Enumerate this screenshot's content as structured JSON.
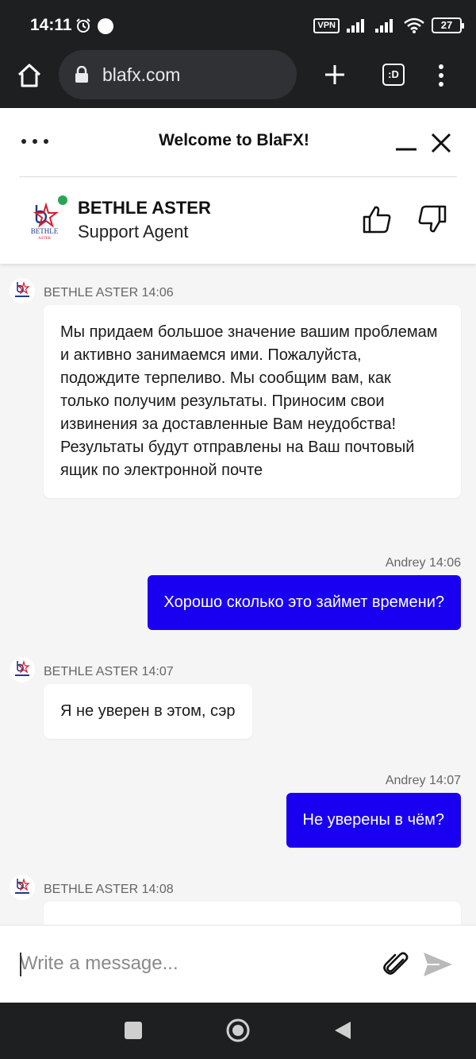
{
  "status_bar": {
    "time": "14:11",
    "vpn": "VPN",
    "battery": "27"
  },
  "browser": {
    "url": "blafx.com",
    "tabs_icon_text": ":D"
  },
  "chat": {
    "title": "Welcome to BlaFX!",
    "agent": {
      "name": "BETHLE ASTER",
      "role": "Support Agent",
      "status_color": "#2aa457",
      "logo_text": "BETHLE",
      "logo_subtext": "ASTER"
    }
  },
  "messages": [
    {
      "from": "agent",
      "meta": "BETHLE ASTER 14:06",
      "text": "Мы придаем большое значение вашим проблемам и активно занимаемся ими. Пожалуйста, подождите терпеливо. Мы сообщим вам, как только получим результаты. Приносим свои извинения за доставленные Вам неудобства!Результаты будут отправлены на Ваш почтовый ящик по электронной почте"
    },
    {
      "from": "user",
      "meta": "Andrey 14:06",
      "text": "Хорошо сколько это займет времени?"
    },
    {
      "from": "agent",
      "meta": "BETHLE ASTER 14:07",
      "text": "Я не уверен в этом, сэр"
    },
    {
      "from": "user",
      "meta": "Andrey 14:07",
      "text": "Не уверены в чём?"
    },
    {
      "from": "agent",
      "meta": "BETHLE ASTER 14:08",
      "text": ""
    }
  ],
  "composer": {
    "placeholder": "Write a message..."
  },
  "colors": {
    "user_bubble": "#1a00f0",
    "agent_bubble": "#ffffff",
    "chat_background": "#f5f5f5"
  }
}
